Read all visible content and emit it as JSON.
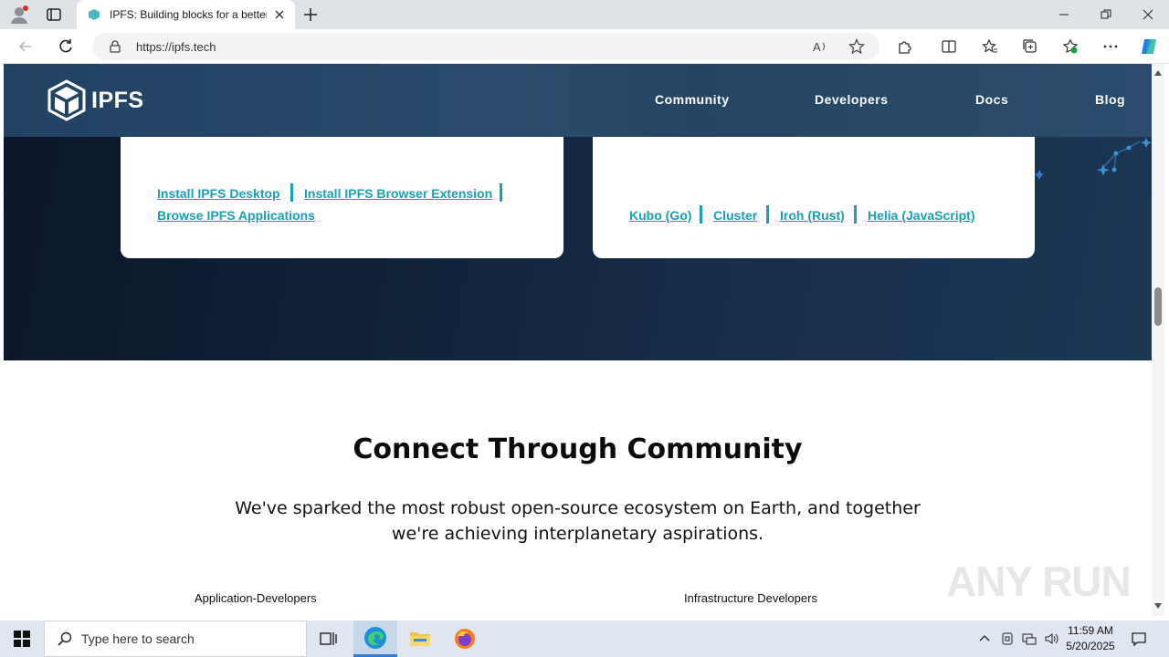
{
  "browser": {
    "tab_title": "IPFS: Building blocks for a better",
    "url": "https://ipfs.tech"
  },
  "site": {
    "logo_text": "IPFS",
    "nav": [
      "Community",
      "Developers",
      "Docs",
      "Blog"
    ]
  },
  "cards": {
    "left_links": [
      "Install IPFS Desktop",
      "Install IPFS Browser Extension",
      "Browse IPFS Applications"
    ],
    "right_links": [
      "Kubo (Go)",
      "Cluster",
      "Iroh (Rust)",
      "Helia (JavaScript)"
    ]
  },
  "community": {
    "title": "Connect Through Community",
    "description": "We've sparked the most robust open-source ecosystem on Earth, and together we're achieving interplanetary aspirations.",
    "col_left": "Application-Developers",
    "col_right": "Infrastructure Developers"
  },
  "watermark": "ANY RUN",
  "taskbar": {
    "search_placeholder": "Type here to search",
    "time": "11:59 AM",
    "date": "5/20/2025"
  },
  "colors": {
    "link": "#1a9fb3",
    "header": "#254563",
    "hero_dark": "#0b1628"
  }
}
